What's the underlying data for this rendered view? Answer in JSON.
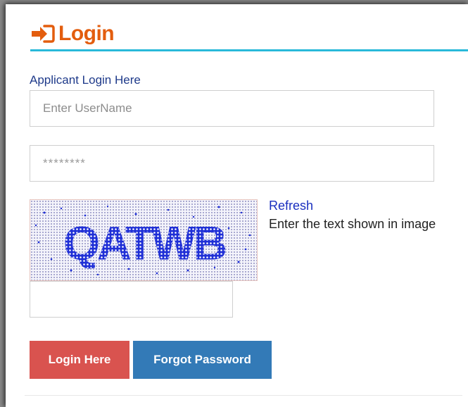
{
  "header": {
    "title": "Login",
    "icon": "sign-in-icon",
    "accent_color": "#e35d0e",
    "rule_color": "#29b9d9"
  },
  "form": {
    "section_label": "Applicant Login Here",
    "username": {
      "placeholder": "Enter UserName",
      "value": ""
    },
    "password": {
      "placeholder": "********",
      "value": ""
    },
    "captcha": {
      "text": "QATWB",
      "refresh_label": "Refresh",
      "hint": "Enter the text shown in image",
      "input_value": ""
    }
  },
  "buttons": {
    "login_label": "Login Here",
    "login_color": "#d9534f",
    "forgot_label": "Forgot Password",
    "forgot_color": "#337ab7"
  }
}
